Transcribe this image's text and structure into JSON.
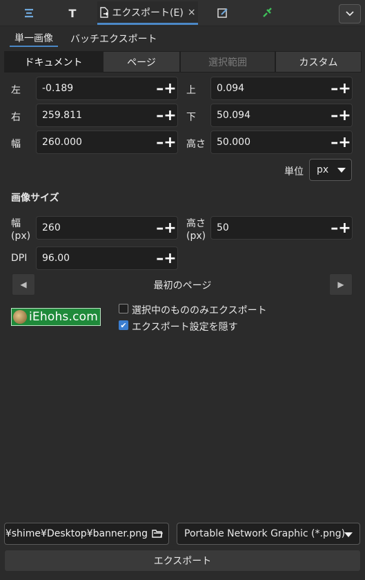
{
  "tabs": [
    {
      "icon": "align-icon",
      "label": ""
    },
    {
      "icon": "text-icon",
      "label": "T"
    },
    {
      "icon": "export-doc-icon",
      "label": "エクスポート(E)",
      "close": "×"
    },
    {
      "icon": "edit-icon",
      "label": ""
    },
    {
      "icon": "wrench-icon",
      "label": ""
    }
  ],
  "subtabs": {
    "single": "単一画像",
    "batch": "バッチエクスポート"
  },
  "area_tabs": [
    "ドキュメント",
    "ページ",
    "選択範囲",
    "カスタム"
  ],
  "area": {
    "left_label": "左",
    "left_value": "-0.189",
    "top_label": "上",
    "top_value": "0.094",
    "right_label": "右",
    "right_value": "259.811",
    "bottom_label": "下",
    "bottom_value": "50.094",
    "width_label": "幅",
    "width_value": "260.000",
    "height_label": "高さ",
    "height_value": "50.000",
    "unit_label": "単位",
    "unit_value": "px"
  },
  "image_size": {
    "title": "画像サイズ",
    "width_label": "幅",
    "width_unit": "(px)",
    "width_value": "260",
    "height_label": "高さ",
    "height_unit": "(px)",
    "height_value": "50",
    "dpi_label": "DPI",
    "dpi_value": "96.00"
  },
  "spin_glyph": "–+",
  "pager": {
    "label": "最初のページ",
    "prev": "◀",
    "next": "▶"
  },
  "preview": {
    "text": "iEhohs.com"
  },
  "options": {
    "selected_only": {
      "label": "選択中のもののみエクスポート",
      "checked": false
    },
    "hide_settings": {
      "label": "エクスポート設定を隠す",
      "checked": true
    }
  },
  "file": {
    "path": "rs¥shime¥Desktop¥banner.png",
    "format": "Portable Network Graphic (*.png)"
  },
  "export_button": "エクスポート",
  "colors": {
    "accent": "#4b88c7",
    "preview_bg": "#1f8a3a"
  }
}
